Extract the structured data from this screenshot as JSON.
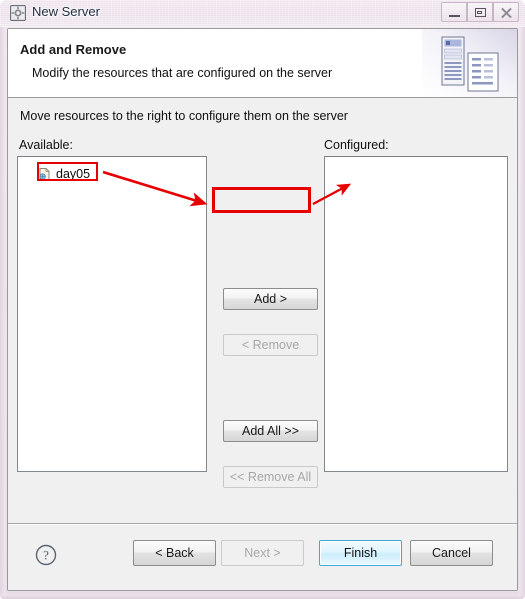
{
  "window": {
    "title": "New Server",
    "icon": "server-gear-icon",
    "controls": {
      "minimize": "minimize-icon",
      "maximize": "maximize-icon",
      "close": "close-icon"
    }
  },
  "wizard": {
    "title": "Add and Remove",
    "description": "Modify the resources that are configured on the server",
    "banner_icon": "server-and-document-icon",
    "instruction": "Move resources to the right to configure them on the server"
  },
  "available": {
    "label": "Available:",
    "items": [
      {
        "name": "day05",
        "icon": "dynamic-web-project-icon"
      }
    ]
  },
  "configured": {
    "label": "Configured:",
    "items": []
  },
  "transfer_buttons": [
    {
      "label": "Add >",
      "name": "add-button",
      "enabled": true
    },
    {
      "label": "< Remove",
      "name": "remove-button",
      "enabled": false
    },
    {
      "label": "Add All >>",
      "name": "add-all-button",
      "enabled": true
    },
    {
      "label": "<< Remove All",
      "name": "remove-all-button",
      "enabled": false
    }
  ],
  "footer": {
    "help_icon": "help-question-icon",
    "buttons": [
      {
        "label": "< Back",
        "name": "back-button",
        "state": "enabled"
      },
      {
        "label": "Next >",
        "name": "next-button",
        "state": "disabled"
      },
      {
        "label": "Finish",
        "name": "finish-button",
        "state": "defaulted"
      },
      {
        "label": "Cancel",
        "name": "cancel-button",
        "state": "enabled"
      }
    ]
  },
  "annotations": {
    "highlight_color": "#e60000",
    "boxes": [
      "day05-list-item",
      "add-button"
    ],
    "arrows": [
      {
        "from": "day05-list-item",
        "to": "add-button"
      },
      {
        "from": "add-button",
        "to": "configured-list"
      }
    ]
  },
  "colors": {
    "titlebar": "#eadfe9",
    "dialog_bg": "#f0f0f0",
    "header_bg": "#ffffff",
    "listbox_bg": "#ffffff",
    "accent_focus": "#3fa9d8"
  }
}
